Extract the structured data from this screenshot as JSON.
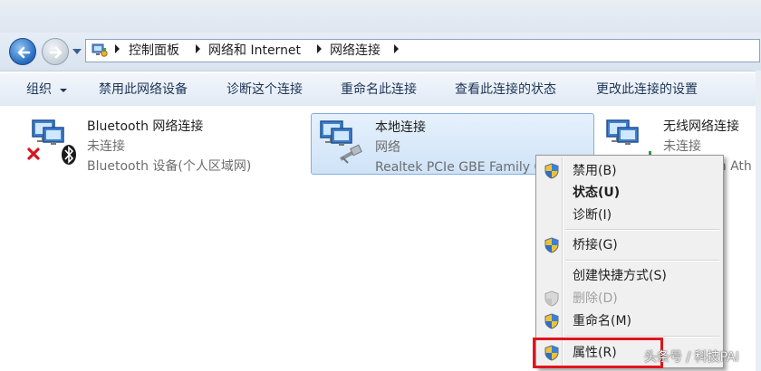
{
  "window": {
    "accent_color": "#2a6fc2",
    "selection_color": "#cfe3f8",
    "highlight_color": "#e0141e"
  },
  "nav": {
    "back_icon": "back-arrow-icon",
    "forward_icon": "forward-arrow-icon",
    "address_icon": "control-panel-icon",
    "breadcrumbs": [
      "控制面板",
      "网络和 Internet",
      "网络连接"
    ]
  },
  "toolbar": {
    "organize": "组织",
    "disable": "禁用此网络设备",
    "diagnose": "诊断这个连接",
    "rename": "重命名此连接",
    "status": "查看此连接的状态",
    "change": "更改此连接的设置"
  },
  "connections": [
    {
      "name": "Bluetooth 网络连接",
      "status": "未连接",
      "device": "Bluetooth 设备(个人区域网)",
      "icon": "bluetooth-network-icon"
    },
    {
      "name": "本地连接",
      "status": "网络",
      "device": "Realtek PCIe GBE Family C",
      "icon": "ethernet-network-icon"
    },
    {
      "name": "无线网络连接",
      "status": "未连接",
      "device": "m Ath",
      "icon": "wireless-network-icon"
    }
  ],
  "context_menu": {
    "disable": "禁用(B)",
    "status": "状态(U)",
    "diagnose": "诊断(I)",
    "bridge": "桥接(G)",
    "shortcut": "创建快捷方式(S)",
    "delete": "删除(D)",
    "rename": "重命名(M)",
    "properties": "属性(R)"
  },
  "watermark": "头条号 / 科技PAI"
}
